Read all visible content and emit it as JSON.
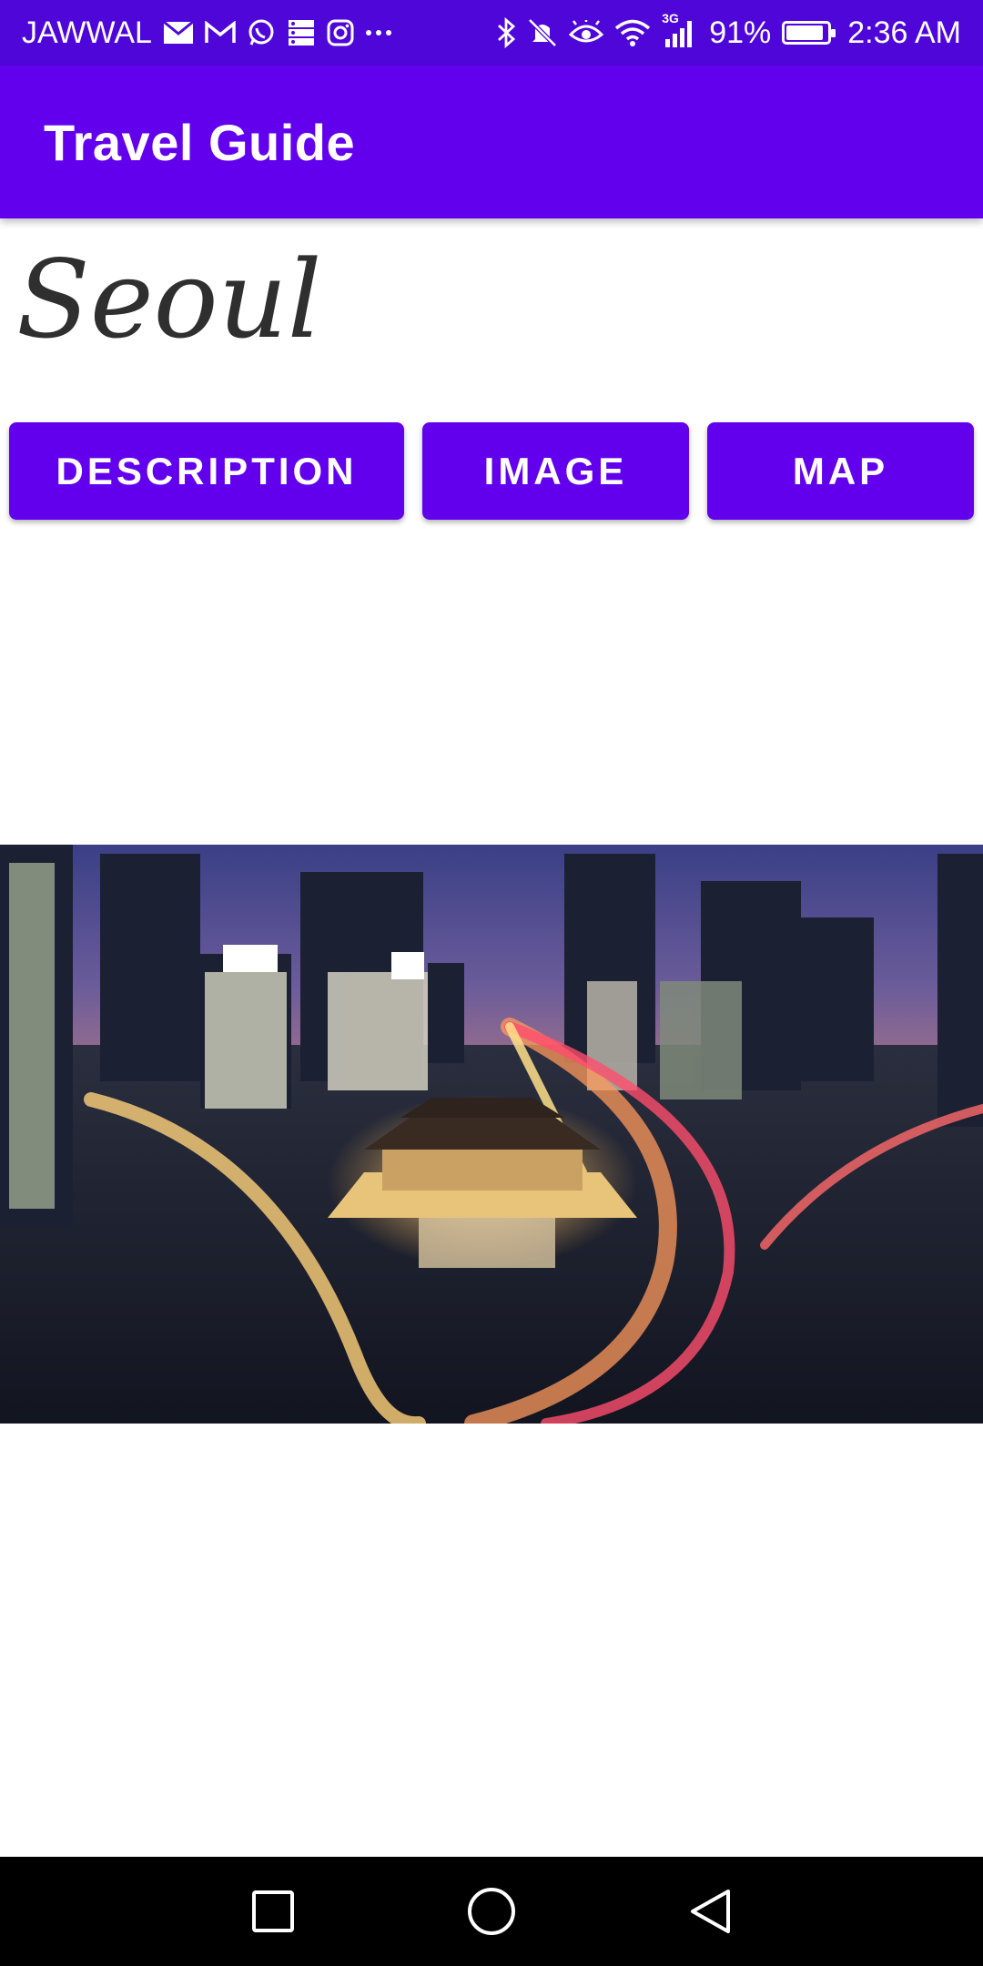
{
  "status_bar": {
    "carrier": "JAWWAL",
    "battery": "91%",
    "battery_level": 0.91,
    "signal_type": "3G",
    "time": "2:36 AM",
    "left_icons": [
      "mail-icon",
      "gmail-icon",
      "whatsapp-icon",
      "storage-icon",
      "instagram-icon",
      "more-notifications-icon"
    ],
    "right_icons": [
      "bluetooth-icon",
      "mute-icon",
      "eye-comfort-icon",
      "wifi-icon",
      "signal-icon",
      "battery-icon"
    ]
  },
  "app_bar": {
    "title": "Travel Guide"
  },
  "city": {
    "name": "Seoul"
  },
  "buttons": {
    "description": "DESCRIPTION",
    "image": "IMAGE",
    "map": "MAP"
  },
  "colors": {
    "status_bar": "#4f07d9",
    "primary": "#6200ee",
    "background": "#ffffff",
    "nav_bar": "#000000",
    "title_text": "#2f2f2f"
  },
  "nav_bar": {
    "icons": [
      "recents-icon",
      "home-icon",
      "back-icon"
    ]
  }
}
